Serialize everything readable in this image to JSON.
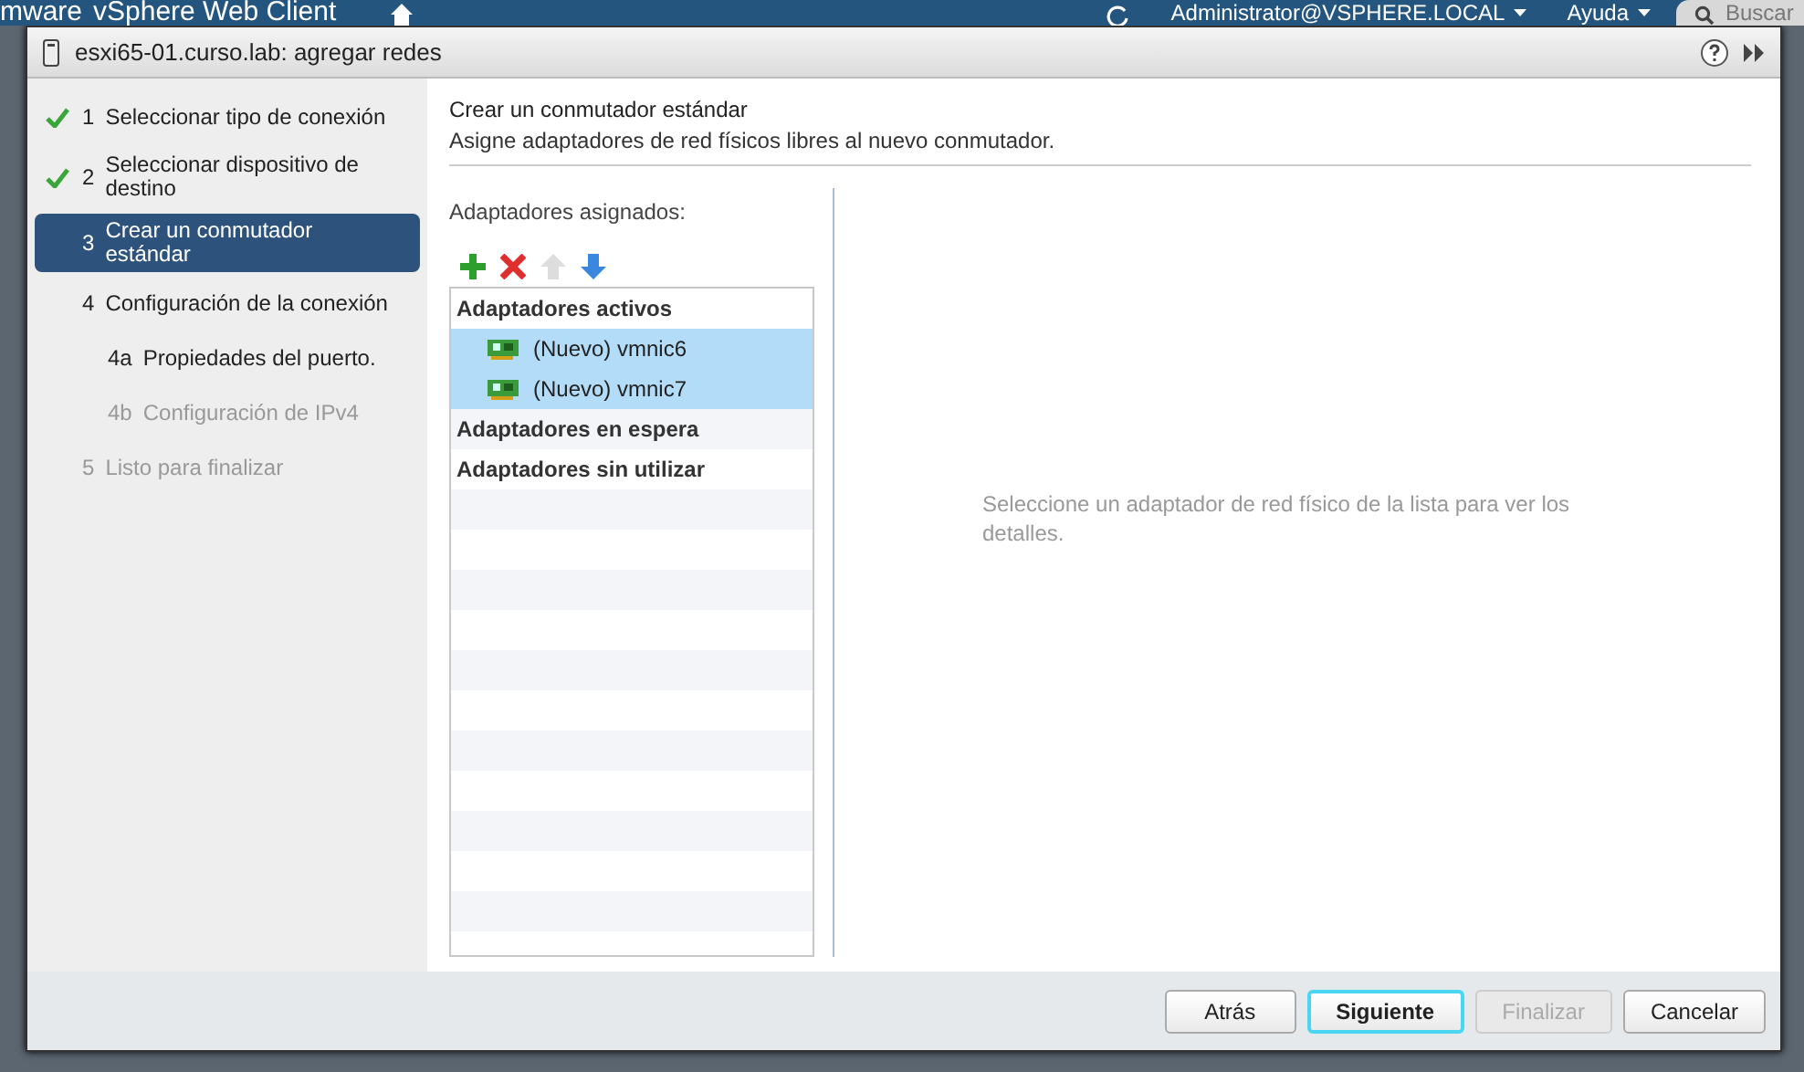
{
  "app_bar": {
    "logo": "mware",
    "product": "vSphere Web Client",
    "user": "Administrator@VSPHERE.LOCAL",
    "help": "Ayuda",
    "search": {
      "placeholder": "Buscar"
    }
  },
  "dialog": {
    "title": "esxi65-01.curso.lab: agregar redes"
  },
  "steps": [
    {
      "number": "1",
      "label": "Seleccionar tipo de conexión",
      "completed": true,
      "selected": false,
      "disabled": false
    },
    {
      "number": "2",
      "label": "Seleccionar dispositivo de destino",
      "completed": true,
      "selected": false,
      "disabled": false
    },
    {
      "number": "3",
      "label": "Crear un conmutador estándar",
      "completed": false,
      "selected": true,
      "disabled": false
    },
    {
      "number": "4",
      "label": "Configuración de la conexión",
      "completed": false,
      "selected": false,
      "disabled": false,
      "children": [
        {
          "number": "4a",
          "label": "Propiedades del puerto.",
          "completed": false,
          "selected": false,
          "disabled": false
        },
        {
          "number": "4b",
          "label": "Configuración de IPv4",
          "completed": false,
          "selected": false,
          "disabled": true
        }
      ]
    },
    {
      "number": "5",
      "label": "Listo para finalizar",
      "completed": false,
      "selected": false,
      "disabled": true
    }
  ],
  "page": {
    "title": "Crear un conmutador estándar",
    "subtitle": "Asigne adaptadores de red físicos libres al nuevo conmutador.",
    "list_label": "Adaptadores asignados:",
    "groups": [
      {
        "label": "Adaptadores activos",
        "adapters": [
          {
            "label": "(Nuevo) vmnic6",
            "selected": true
          },
          {
            "label": "(Nuevo) vmnic7",
            "selected": true
          }
        ]
      },
      {
        "label": "Adaptadores en espera"
      },
      {
        "label": "Adaptadores sin utilizar"
      }
    ],
    "details_hint": "Seleccione un adaptador de red físico de la lista para ver los detalles."
  },
  "buttons": [
    {
      "label": "Atrás",
      "focused": false,
      "disabled": false
    },
    {
      "label": "Siguiente",
      "focused": true,
      "disabled": false
    },
    {
      "label": "Finalizar",
      "focused": false,
      "disabled": true
    },
    {
      "label": "Cancelar",
      "focused": false,
      "disabled": false
    }
  ]
}
